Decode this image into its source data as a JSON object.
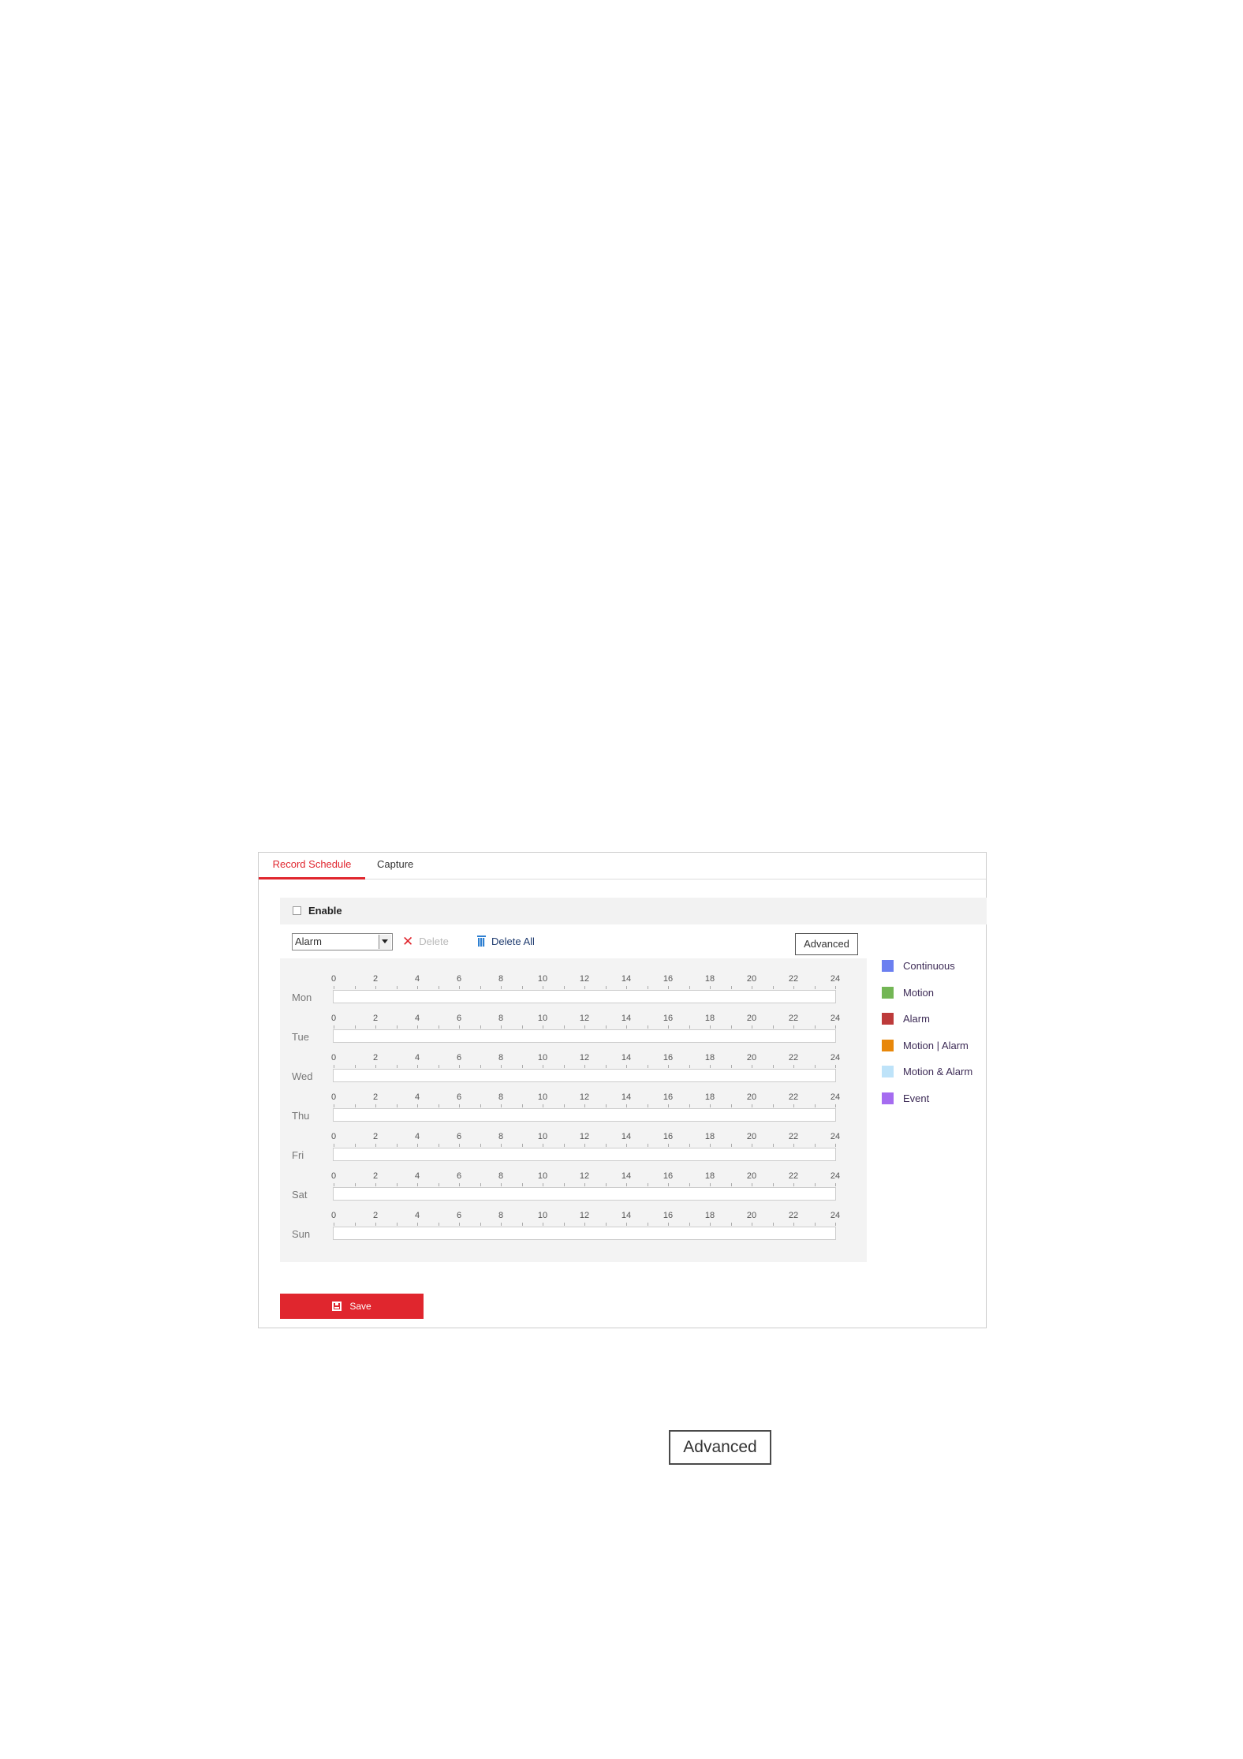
{
  "tabs": [
    {
      "label": "Record Schedule",
      "active": true
    },
    {
      "label": "Capture",
      "active": false
    }
  ],
  "enable": {
    "label": "Enable",
    "checked": false
  },
  "record_type": {
    "selected": "Alarm"
  },
  "toolbar": {
    "delete_label": "Delete",
    "delete_all_label": "Delete All",
    "advanced_label": "Advanced"
  },
  "schedule": {
    "hours": [
      "0",
      "2",
      "4",
      "6",
      "8",
      "10",
      "12",
      "14",
      "16",
      "18",
      "20",
      "22",
      "24"
    ],
    "days": [
      "Mon",
      "Tue",
      "Wed",
      "Thu",
      "Fri",
      "Sat",
      "Sun"
    ]
  },
  "legend": [
    {
      "label": "Continuous",
      "color": "#6b7ff0"
    },
    {
      "label": "Motion",
      "color": "#73b655"
    },
    {
      "label": "Alarm",
      "color": "#bd3a3a"
    },
    {
      "label": "Motion | Alarm",
      "color": "#e8870a"
    },
    {
      "label": "Motion & Alarm",
      "color": "#bee3f9"
    },
    {
      "label": "Event",
      "color": "#a56cf0"
    }
  ],
  "save_label": "Save",
  "standalone_advanced_label": "Advanced",
  "colors": {
    "accent": "#e0262e"
  }
}
